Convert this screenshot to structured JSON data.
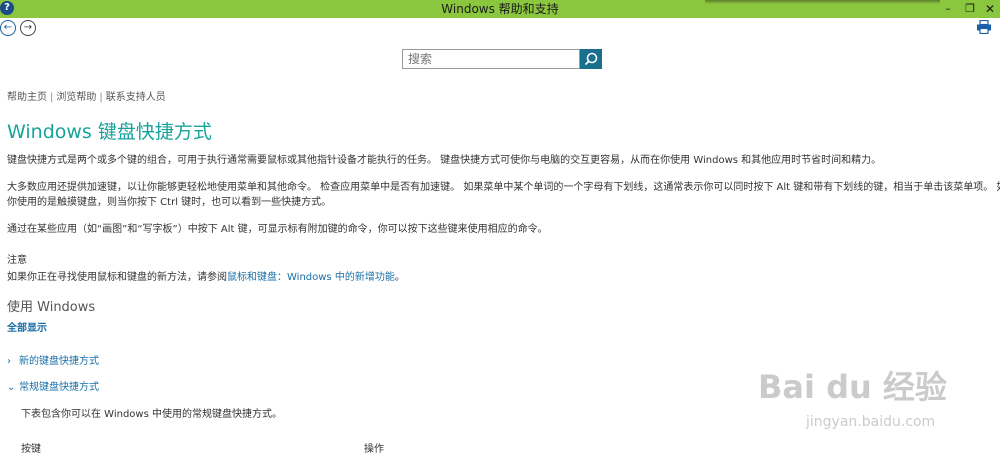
{
  "titlebar": {
    "title": "Windows 帮助和支持",
    "help_glyph": "?",
    "minimize_glyph": "–",
    "restore_glyph": "❐",
    "close_glyph": "✕",
    "bg_color": "#8bc63f"
  },
  "nav": {
    "back_glyph": "←",
    "forward_glyph": "→",
    "print_icon": "printer-icon"
  },
  "search": {
    "placeholder": "搜索",
    "button_icon": "search-icon"
  },
  "breadcrumb": {
    "items": [
      "帮助主页",
      "浏览帮助",
      "联系支持人员"
    ],
    "separator": "|"
  },
  "page": {
    "title": "Windows 键盘快捷方式",
    "title_color": "#18a39a",
    "p1": "键盘快捷方式是两个或多个键的组合，可用于执行通常需要鼠标或其他指针设备才能执行的任务。 键盘快捷方式可使你与电脑的交互更容易，从而在你使用 Windows 和其他应用时节省时间和精力。",
    "p2_line1": "大多数应用还提供加速键，以让你能够更轻松地使用菜单和其他命令。 检查应用菜单中是否有加速键。 如果菜单中某个单词的一个字母有下划线，这通常表示你可以同时按下 Alt 键和带有下划线的键，相当于单击该菜单项。 如果",
    "p2_line2": "你使用的是触摸键盘，则当你按下 Ctrl 键时，也可以看到一些快捷方式。",
    "p3": "通过在某些应用（如“画图”和“写字板”）中按下 Alt 键，可显示标有附加键的命令，你可以按下这些键来使用相应的命令。",
    "note_heading": "注意",
    "note_prefix": "如果你正在寻找使用鼠标和键盘的新方法，请参阅",
    "note_link": "鼠标和键盘：Windows 中的新增功能",
    "note_suffix": "。",
    "section_heading": "使用 Windows",
    "show_all": "全部显示",
    "expander1_label": "新的键盘快捷方式",
    "expander1_glyph": "›",
    "expander2_label": "常规键盘快捷方式",
    "expander2_glyph": "⌄",
    "sub_paragraph": "下表包含你可以在 Windows 中使用的常规键盘快捷方式。",
    "table_header_key": "按键",
    "table_header_action": "操作",
    "link_color": "#1a6fa8"
  },
  "watermark": {
    "main": "Bai du 经验",
    "sub": "jingyan.baidu.com"
  }
}
